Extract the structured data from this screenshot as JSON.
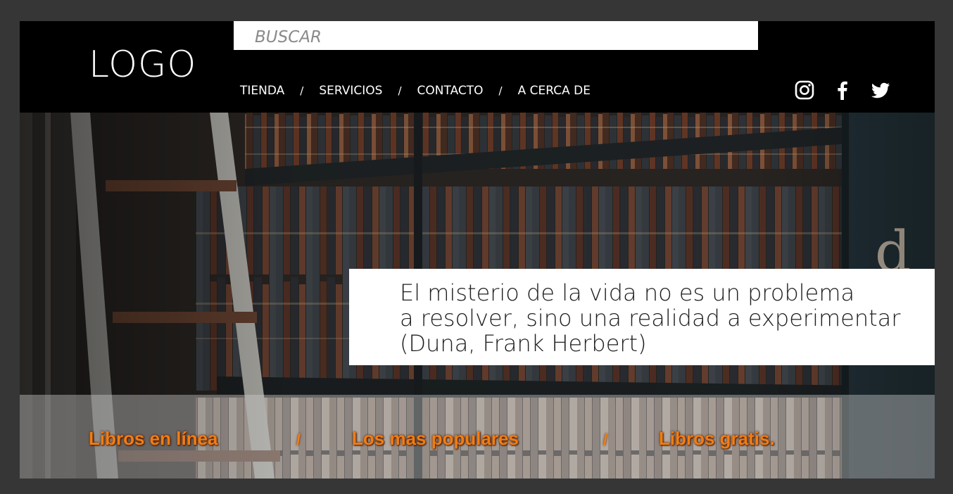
{
  "header": {
    "logo": "LOGO",
    "search_placeholder": "BUSCAR",
    "nav": {
      "items": [
        "TIENDA",
        "SERVICIOS",
        "CONTACTO",
        "A CERCA DE"
      ],
      "separator": "/"
    },
    "social": [
      "instagram-icon",
      "facebook-icon",
      "twitter-icon"
    ]
  },
  "hero": {
    "quote": "El misterio de la vida no es un problema\na resolver, sino una realidad a experimentar\n(Duna, Frank Herbert)",
    "links": [
      "Libros en línea",
      "Los mas populares",
      "Libros gratis."
    ],
    "separator": "/"
  },
  "colors": {
    "header_bg": "#000000",
    "accent": "#f07d12",
    "page_bg": "#363636"
  }
}
